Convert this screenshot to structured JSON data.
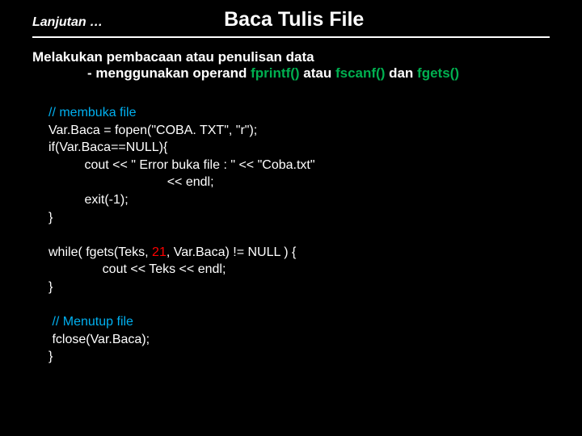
{
  "header": {
    "cont_label": "Lanjutan …",
    "title": "Baca Tulis File"
  },
  "desc": {
    "line1": "Melakukan pembacaan atau penulisan data",
    "line2_prefix": "- menggunakan operand ",
    "kw_fprintf": "fprintf()",
    "mid1": " atau ",
    "kw_fscanf": "fscanf()",
    "mid2": " dan ",
    "kw_fgets": "fgets()"
  },
  "code": {
    "c1": "// membuka file",
    "l2": "Var.Baca = fopen(\"COBA. TXT\", \"r\");",
    "l3": "if(Var.Baca==NULL){",
    "l4": "          cout << \" Error buka file : \" << \"Coba.txt\"",
    "l5": "                                 << endl;",
    "l6": "          exit(-1);",
    "l7": "}",
    "l8a": "while( fgets(Teks, ",
    "l8num": "21",
    "l8b": ", Var.Baca) != NULL ) {",
    "l9": "               cout << Teks << endl;",
    "l10": "}",
    "c11": " // Menutup file",
    "l12": " fclose(Var.Baca);",
    "l13": "}"
  }
}
